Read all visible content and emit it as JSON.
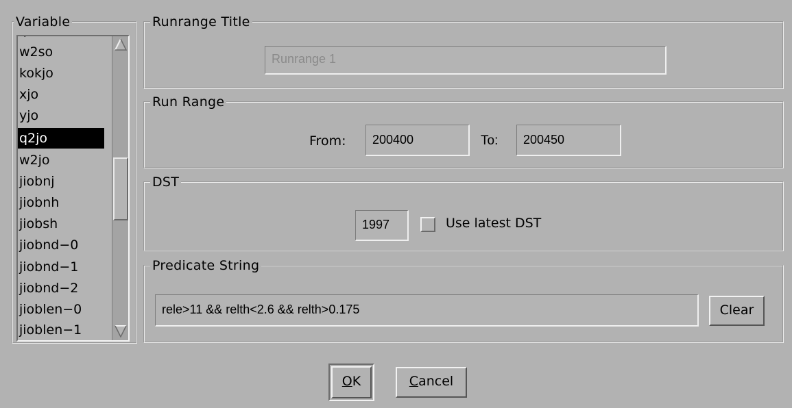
{
  "variable_panel": {
    "title": "Variable",
    "items": [
      "w2so",
      "kokjo",
      "xjo",
      "yjo",
      "q2jo",
      "w2jo",
      "jiobnj",
      "jiobnh",
      "jiobsh",
      "jiobnd−0",
      "jiobnd−1",
      "jiobnd−2",
      "jioblen−0",
      "jioblen−1"
    ],
    "selected": "q2jo"
  },
  "runrange_title": {
    "legend": "Runrange Title",
    "value": "Runrange 1"
  },
  "run_range": {
    "legend": "Run Range",
    "from_label": "From:",
    "from_value": "200400",
    "to_label": "To:",
    "to_value": "200450"
  },
  "dst": {
    "legend": "DST",
    "year_value": "1997",
    "use_latest_label": "Use latest DST",
    "use_latest_checked": false
  },
  "predicate": {
    "legend": "Predicate String",
    "value": "rele>11 && relth<2.6 && relth>0.175",
    "clear_label": "Clear"
  },
  "buttons": {
    "ok_mnemonic": "O",
    "ok_rest": "K",
    "cancel_mnemonic": "C",
    "cancel_rest": "ancel"
  },
  "colors": {
    "background": "#b2b2b2",
    "selection": "#000000",
    "disabled_text": "#8a8a8a"
  }
}
